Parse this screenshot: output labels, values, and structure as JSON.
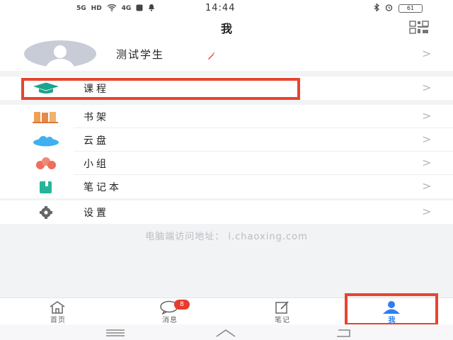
{
  "status_bar": {
    "network_labels": [
      "5G",
      "HD",
      "4G"
    ],
    "time": "14:44",
    "battery": "61"
  },
  "header": {
    "title": "我",
    "qr_icon": "qr-code-icon"
  },
  "profile": {
    "name": "测试学生",
    "avatar_icon": "default-avatar-icon",
    "edit_icon": "pencil-icon"
  },
  "menu": [
    {
      "label": "课程",
      "icon": "graduation-cap-icon",
      "color": "#1aa58c"
    },
    {
      "label": "书架",
      "icon": "bookshelf-icon",
      "color": "#f0a052"
    },
    {
      "label": "云盘",
      "icon": "cloud-icon",
      "color": "#3fb0f0"
    },
    {
      "label": "小组",
      "icon": "group-icon",
      "color": "#ef6e5e"
    },
    {
      "label": "笔记本",
      "icon": "notebook-icon",
      "color": "#27b59a"
    },
    {
      "label": "设置",
      "icon": "gear-icon",
      "color": "#666666"
    }
  ],
  "chevron": ">",
  "web_hint": "电脑端访问地址： i.chaoxing.com",
  "tabs": [
    {
      "label": "首页",
      "icon": "home-icon"
    },
    {
      "label": "消息",
      "icon": "message-icon",
      "badge": "8"
    },
    {
      "label": "笔记",
      "icon": "note-edit-icon"
    },
    {
      "label": "我",
      "icon": "person-icon",
      "active": true
    }
  ],
  "colors": {
    "accent": "#2d7ff0",
    "highlight": "#e8442e",
    "badge": "#e63b2e"
  }
}
